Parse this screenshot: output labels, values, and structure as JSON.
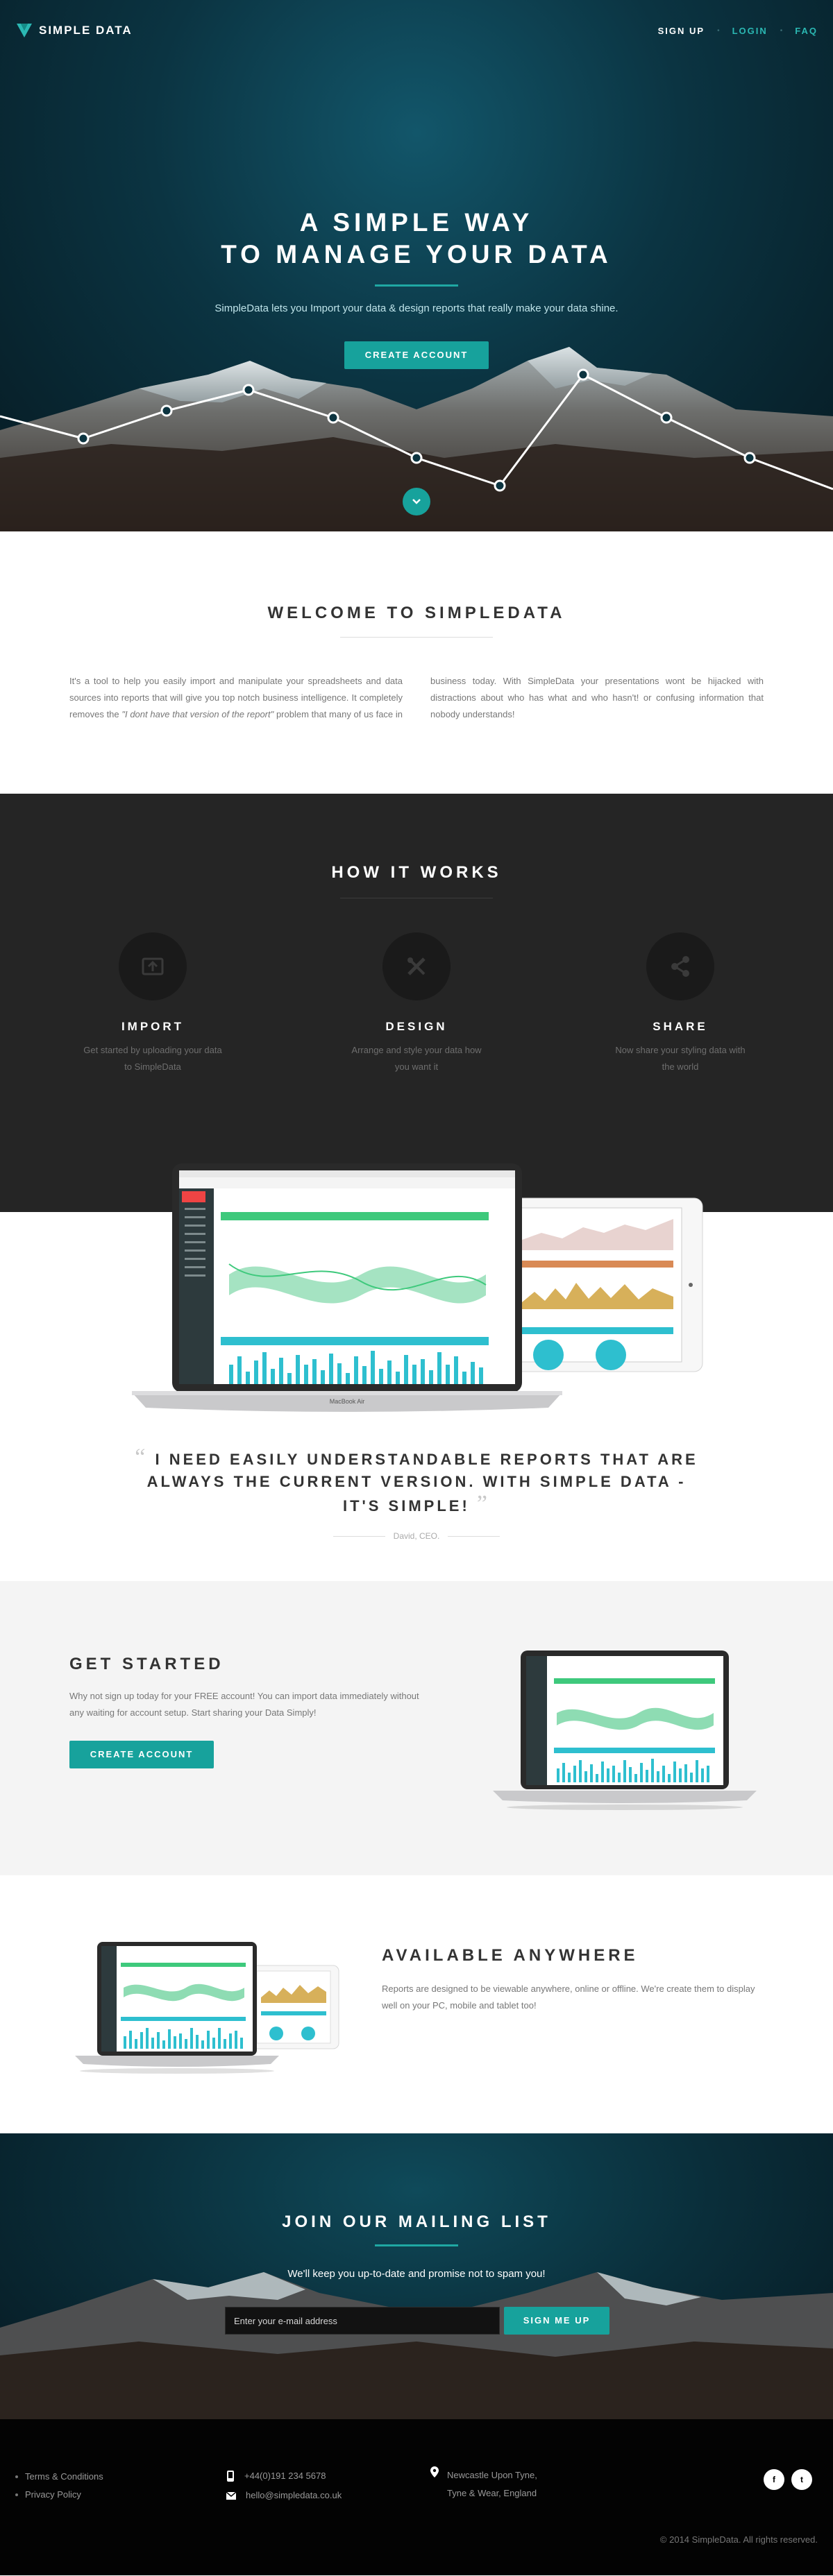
{
  "nav": {
    "brand": "SIMPLE DATA",
    "links": [
      {
        "label": "SIGN UP"
      },
      {
        "label": "LOGIN"
      },
      {
        "label": "FAQ"
      }
    ]
  },
  "hero": {
    "title_line1": "A SIMPLE WAY",
    "title_line2": "TO MANAGE YOUR DATA",
    "subtitle": "SimpleData lets you Import your data & design reports that really make your data shine.",
    "cta": "CREATE ACCOUNT",
    "scroll_icon": "chevron-down-icon"
  },
  "welcome": {
    "title": "WELCOME TO SIMPLEDATA",
    "text_before": "It's a tool to help you easily import and manipulate your spreadsheets and data sources into reports that will give you top notch business intelligence. It completely removes the ",
    "text_quote": "\"I dont have that version of the report\"",
    "text_after": " problem that many of us face in business today. With SimpleData your presentations wont be hijacked with distractions about who has what and who hasn't! or confusing information that nobody understands!"
  },
  "how": {
    "title": "HOW IT WORKS",
    "steps": [
      {
        "icon": "upload-icon",
        "title": "IMPORT",
        "desc": "Get started by uploading your data to SimpleData"
      },
      {
        "icon": "design-tools-icon",
        "title": "DESIGN",
        "desc": "Arrange and style your data how you want it"
      },
      {
        "icon": "share-icon",
        "title": "SHARE",
        "desc": "Now share your styling data with the world"
      }
    ]
  },
  "devices": {
    "laptop_label": "MacBook Air"
  },
  "quote": {
    "text": "I NEED EASILY UNDERSTANDABLE REPORTS THAT ARE ALWAYS THE CURRENT VERSION. WITH SIMPLE DATA - IT'S SIMPLE!",
    "author": "David, CEO."
  },
  "get_started": {
    "title": "GET STARTED",
    "text": "Why not sign up today for your FREE account! You can import data immediately without any waiting for account setup. Start sharing your Data Simply!",
    "cta": "CREATE ACCOUNT"
  },
  "available": {
    "title": "AVAILABLE ANYWHERE",
    "text": "Reports are designed to be viewable anywhere, online or offline. We're create them to display well on your PC, mobile and tablet too!"
  },
  "mailing": {
    "title": "JOIN OUR MAILING LIST",
    "subtitle": "We'll keep you up-to-date and promise not to spam you!",
    "placeholder": "Enter your e-mail address",
    "button": "SIGN ME UP"
  },
  "footer": {
    "links": [
      {
        "label": "Terms & Conditions"
      },
      {
        "label": "Privacy Policy"
      }
    ],
    "phone": "+44(0)191 234 5678",
    "email": "hello@simpledata.co.uk",
    "address_line1": "Newcastle Upon Tyne,",
    "address_line2": "Tyne & Wear, England",
    "social": [
      {
        "icon": "facebook-icon",
        "glyph": "f"
      },
      {
        "icon": "twitter-icon",
        "glyph": "t"
      }
    ],
    "copyright": "© 2014 SimpleData. All rights reserved."
  },
  "colors": {
    "accent": "#17a29c",
    "dark": "#252525",
    "footer": "#030303"
  }
}
